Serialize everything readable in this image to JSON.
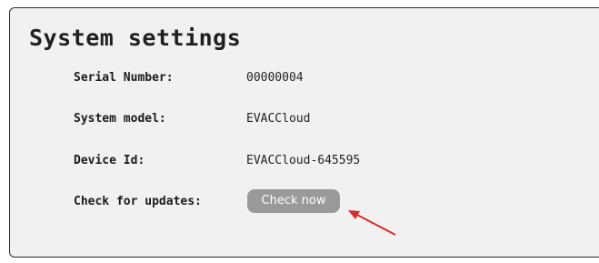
{
  "page": {
    "title": "System settings"
  },
  "settings": {
    "serial": {
      "label": "Serial Number:",
      "value": "00000004"
    },
    "model": {
      "label": "System model:",
      "value": "EVACCloud"
    },
    "device": {
      "label": "Device Id:",
      "value": "EVACCloud-645595"
    },
    "updates": {
      "label": "Check for updates:",
      "button_label": "Check now"
    }
  },
  "colors": {
    "panel_bg": "#f1f1f1",
    "button_bg": "#9a9a9a",
    "annotation_arrow": "#d92b2b"
  }
}
